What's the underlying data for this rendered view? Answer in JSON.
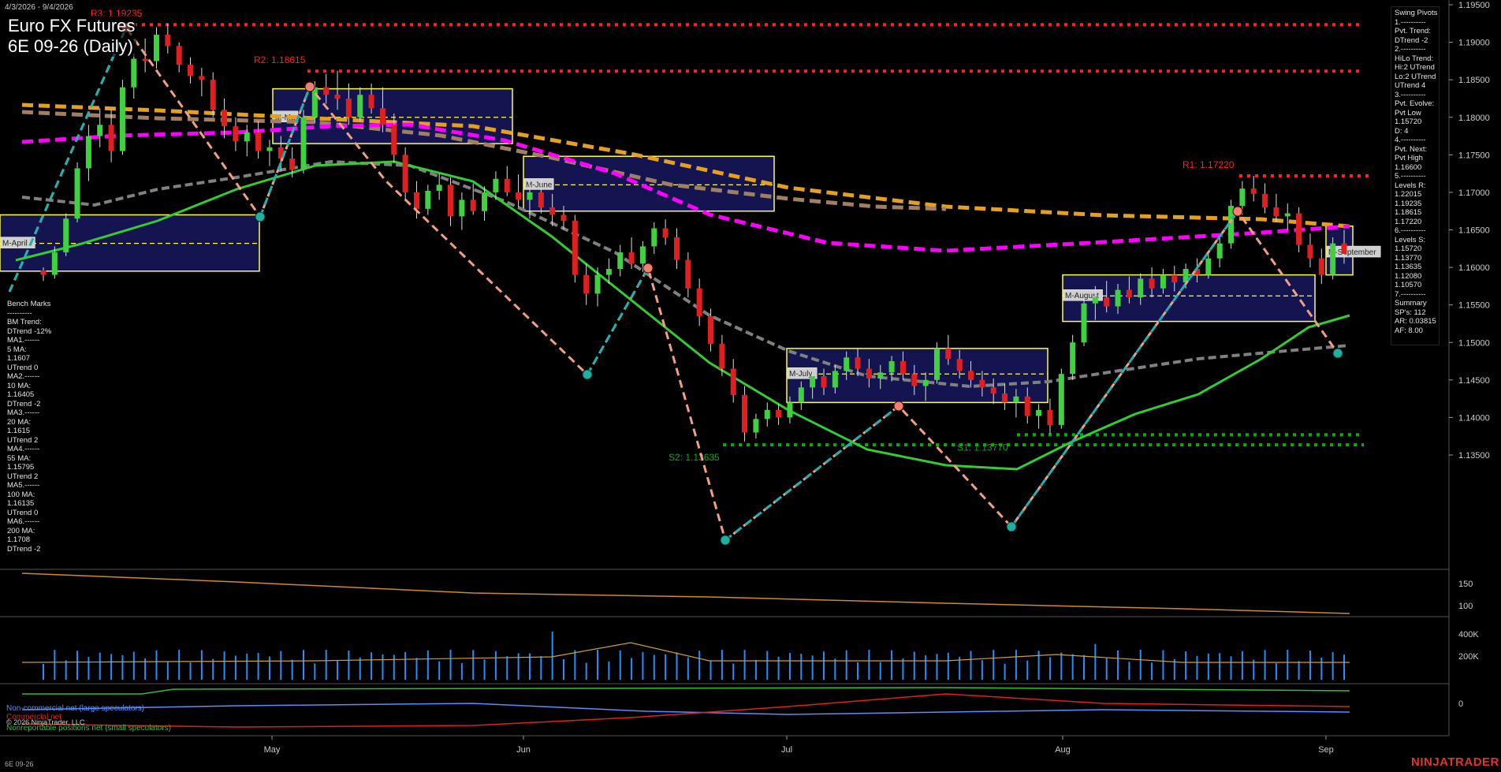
{
  "header": {
    "date_range": "4/3/2026 - 9/4/2026",
    "title_line1": "Euro FX Futures",
    "title_line2": "6E 09-26 (Daily)"
  },
  "footer": {
    "symbol": "6E 09-26",
    "brand": "NINJATRADER"
  },
  "copyright": "© 2026 NinjaTrader, LLC",
  "cot_legend": {
    "noncommercial": "Non-commercial net (large speculators)",
    "commercial": "Commercial net",
    "nonreportable": "Nonreportable positions net (small speculators)"
  },
  "swing_panel": [
    "Swing Pivots",
    "1.----------",
    "Pvt. Trend:",
    "DTrend -2",
    "2.----------",
    "HiLo Trend:",
    "Hi:2 UTrend",
    "Lo:2 UTrend",
    "UTrend 4",
    "3.----------",
    "Pvt. Evolve:",
    "Pvt Low",
    "1.15720",
    "D: 4",
    "4.----------",
    "Pvt. Next:",
    "Pvt High",
    "1.16600",
    "5.----------",
    "Levels R:",
    "1.22015",
    "1.19235",
    "1.18615",
    "1.17220",
    "6.----------",
    "Levels S:",
    "1.15720",
    "1.13770",
    "1.13635",
    "1.12080",
    "1.10570",
    "7.----------",
    "Summary",
    "SP's: 112",
    "AR: 0.03815",
    "AF: 8.00"
  ],
  "bm_panel": [
    "Bench Marks",
    "----------",
    "BM Trend:",
    "DTrend -12%",
    "MA1.------",
    "5 MA:",
    "1.1607",
    "UTrend 0",
    "MA2.------",
    "10 MA:",
    "1.16405",
    "DTrend -2",
    "MA3.------",
    "20 MA:",
    "1.1615",
    "UTrend 2",
    "MA4.------",
    "55 MA:",
    "1.15795",
    "UTrend 2",
    "MA5.------",
    "100 MA:",
    "1.16135",
    "UTrend 0",
    "MA6.------",
    "200 MA:",
    "1.1708",
    "DTrend -2"
  ],
  "colors": {
    "background": "#000000",
    "up_candle": "#3fd13f",
    "down_candle": "#e02020",
    "ma_green": "#33cc33",
    "ma_gray": "#808080",
    "ma_magenta": "#ff00ff",
    "ma_orange": "#e6a020",
    "ma_tan": "#a08060",
    "resistance": "#ff2020",
    "support": "#00b000",
    "swing_up": "#20b0b0",
    "swing_down": "#f0a080",
    "value_area": "#141450",
    "value_area_border": "#ffff40",
    "volume": "#1e90ff",
    "brand": "#e0342b"
  },
  "chart_data": {
    "type": "candlestick",
    "title": "Euro FX Futures 6E 09-26 (Daily)",
    "price_axis": {
      "range": [
        1.131,
        1.1955
      ],
      "ticks": [
        "1.19500",
        "1.19000",
        "1.18500",
        "1.18000",
        "1.17500",
        "1.17000",
        "1.16500",
        "1.16000",
        "1.15500",
        "1.15000",
        "1.14500",
        "1.14000",
        "1.13500"
      ]
    },
    "date_axis_ticks": [
      "May",
      "Jun",
      "Jul",
      "Aug",
      "Sep"
    ],
    "levels": [
      {
        "label": "R3: 1.19235",
        "value": 1.19235,
        "kind": "resistance"
      },
      {
        "label": "R2: 1.18615",
        "value": 1.18615,
        "kind": "resistance"
      },
      {
        "label": "R1: 1.17220",
        "value": 1.1722,
        "kind": "resistance"
      },
      {
        "label": "S2: 1.13635",
        "value": 1.13635,
        "kind": "support"
      },
      {
        "label": "S1: 1.13770",
        "value": 1.1377,
        "kind": "support"
      }
    ],
    "monthly_value_areas": [
      {
        "label": "M-April",
        "high": 1.167,
        "low": 1.1595,
        "mid": 1.1632
      },
      {
        "label": "M-May",
        "high": 1.1838,
        "low": 1.1765,
        "mid": 1.18
      },
      {
        "label": "M-June",
        "high": 1.1748,
        "low": 1.1675,
        "mid": 1.171
      },
      {
        "label": "M-July",
        "high": 1.1492,
        "low": 1.142,
        "mid": 1.1458
      },
      {
        "label": "M-August",
        "high": 1.159,
        "low": 1.1528,
        "mid": 1.1562
      },
      {
        "label": "M-September",
        "high": 1.1655,
        "low": 1.159,
        "mid": 1.162
      }
    ],
    "candles": [
      [
        1.1596,
        1.16,
        1.1582,
        1.159
      ],
      [
        1.159,
        1.1628,
        1.1585,
        1.162
      ],
      [
        1.162,
        1.1672,
        1.1615,
        1.1665
      ],
      [
        1.1665,
        1.174,
        1.166,
        1.1732
      ],
      [
        1.1732,
        1.179,
        1.1715,
        1.1775
      ],
      [
        1.1775,
        1.1812,
        1.176,
        1.179
      ],
      [
        1.179,
        1.181,
        1.174,
        1.1755
      ],
      [
        1.1755,
        1.185,
        1.175,
        1.184
      ],
      [
        1.184,
        1.1885,
        1.1825,
        1.1878
      ],
      [
        1.1878,
        1.1905,
        1.186,
        1.1875
      ],
      [
        1.1875,
        1.192,
        1.1865,
        1.191
      ],
      [
        1.191,
        1.1925,
        1.1885,
        1.1895
      ],
      [
        1.1895,
        1.19,
        1.186,
        1.187
      ],
      [
        1.187,
        1.188,
        1.1845,
        1.1855
      ],
      [
        1.1855,
        1.1866,
        1.1828,
        1.185
      ],
      [
        1.185,
        1.186,
        1.18,
        1.181
      ],
      [
        1.181,
        1.1825,
        1.1772,
        1.1788
      ],
      [
        1.1788,
        1.18,
        1.1755,
        1.1768
      ],
      [
        1.1768,
        1.179,
        1.1748,
        1.178
      ],
      [
        1.178,
        1.1795,
        1.1745,
        1.1755
      ],
      [
        1.1755,
        1.177,
        1.1735,
        1.176
      ],
      [
        1.176,
        1.1775,
        1.1728,
        1.1745
      ],
      [
        1.1745,
        1.176,
        1.172,
        1.173
      ],
      [
        1.173,
        1.181,
        1.1725,
        1.18
      ],
      [
        1.18,
        1.1848,
        1.1792,
        1.184
      ],
      [
        1.184,
        1.1858,
        1.1818,
        1.183
      ],
      [
        1.183,
        1.1862,
        1.181,
        1.1825
      ],
      [
        1.1825,
        1.1845,
        1.179,
        1.18
      ],
      [
        1.18,
        1.184,
        1.1795,
        1.183
      ],
      [
        1.183,
        1.1845,
        1.1805,
        1.1812
      ],
      [
        1.1812,
        1.184,
        1.178,
        1.179
      ],
      [
        1.179,
        1.1805,
        1.174,
        1.175
      ],
      [
        1.175,
        1.176,
        1.169,
        1.17
      ],
      [
        1.17,
        1.1715,
        1.1665,
        1.1678
      ],
      [
        1.1678,
        1.171,
        1.167,
        1.1702
      ],
      [
        1.1702,
        1.1725,
        1.169,
        1.171
      ],
      [
        1.171,
        1.172,
        1.1655,
        1.1668
      ],
      [
        1.1668,
        1.17,
        1.165,
        1.169
      ],
      [
        1.169,
        1.1712,
        1.167,
        1.1675
      ],
      [
        1.1675,
        1.1708,
        1.1662,
        1.17
      ],
      [
        1.17,
        1.1728,
        1.169,
        1.1718
      ],
      [
        1.1718,
        1.1735,
        1.1695,
        1.17
      ],
      [
        1.17,
        1.1724,
        1.168,
        1.169
      ],
      [
        1.169,
        1.171,
        1.1665,
        1.17
      ],
      [
        1.17,
        1.1718,
        1.1672,
        1.168
      ],
      [
        1.168,
        1.1698,
        1.1655,
        1.167
      ],
      [
        1.167,
        1.1682,
        1.165,
        1.1662
      ],
      [
        1.1662,
        1.167,
        1.158,
        1.159
      ],
      [
        1.159,
        1.1605,
        1.155,
        1.1565
      ],
      [
        1.1565,
        1.16,
        1.1548,
        1.159
      ],
      [
        1.159,
        1.1612,
        1.1578,
        1.1598
      ],
      [
        1.1598,
        1.163,
        1.1588,
        1.162
      ],
      [
        1.162,
        1.164,
        1.1598,
        1.1605
      ],
      [
        1.1605,
        1.1635,
        1.1594,
        1.1628
      ],
      [
        1.1628,
        1.166,
        1.1618,
        1.1652
      ],
      [
        1.1652,
        1.1664,
        1.163,
        1.164
      ],
      [
        1.164,
        1.1652,
        1.1598,
        1.161
      ],
      [
        1.161,
        1.162,
        1.156,
        1.1572
      ],
      [
        1.1572,
        1.1585,
        1.1522,
        1.1535
      ],
      [
        1.1535,
        1.1545,
        1.1488,
        1.1498
      ],
      [
        1.1498,
        1.151,
        1.1455,
        1.1465
      ],
      [
        1.1465,
        1.1478,
        1.142,
        1.143
      ],
      [
        1.143,
        1.1442,
        1.1368,
        1.138
      ],
      [
        1.138,
        1.1405,
        1.1372,
        1.1398
      ],
      [
        1.1398,
        1.142,
        1.1388,
        1.141
      ],
      [
        1.141,
        1.1418,
        1.139,
        1.14
      ],
      [
        1.14,
        1.1428,
        1.1392,
        1.142
      ],
      [
        1.142,
        1.1448,
        1.141,
        1.144
      ],
      [
        1.144,
        1.1462,
        1.1425,
        1.1455
      ],
      [
        1.1455,
        1.1465,
        1.143,
        1.144
      ],
      [
        1.144,
        1.147,
        1.1432,
        1.1462
      ],
      [
        1.1462,
        1.1488,
        1.145,
        1.148
      ],
      [
        1.148,
        1.1492,
        1.1455,
        1.1465
      ],
      [
        1.1465,
        1.1478,
        1.144,
        1.1452
      ],
      [
        1.1452,
        1.147,
        1.1438,
        1.146
      ],
      [
        1.146,
        1.1482,
        1.1448,
        1.1475
      ],
      [
        1.1475,
        1.1488,
        1.145,
        1.1458
      ],
      [
        1.1458,
        1.147,
        1.143,
        1.1442
      ],
      [
        1.1442,
        1.146,
        1.1422,
        1.145
      ],
      [
        1.145,
        1.15,
        1.1445,
        1.1492
      ],
      [
        1.1492,
        1.151,
        1.147,
        1.1478
      ],
      [
        1.1478,
        1.149,
        1.1452,
        1.1462
      ],
      [
        1.1462,
        1.1475,
        1.144,
        1.145
      ],
      [
        1.145,
        1.1462,
        1.1428,
        1.144
      ],
      [
        1.144,
        1.1452,
        1.1418,
        1.1432
      ],
      [
        1.1432,
        1.1445,
        1.141,
        1.142
      ],
      [
        1.142,
        1.1438,
        1.14,
        1.1428
      ],
      [
        1.1428,
        1.144,
        1.1392,
        1.1402
      ],
      [
        1.1402,
        1.1418,
        1.1385,
        1.141
      ],
      [
        1.141,
        1.1425,
        1.1378,
        1.139
      ],
      [
        1.139,
        1.1465,
        1.1385,
        1.1458
      ],
      [
        1.1458,
        1.151,
        1.145,
        1.15
      ],
      [
        1.15,
        1.156,
        1.1495,
        1.1552
      ],
      [
        1.1552,
        1.1575,
        1.153,
        1.156
      ],
      [
        1.156,
        1.1582,
        1.154,
        1.1548
      ],
      [
        1.1548,
        1.1578,
        1.1538,
        1.157
      ],
      [
        1.157,
        1.1588,
        1.1552,
        1.156
      ],
      [
        1.156,
        1.1592,
        1.155,
        1.1585
      ],
      [
        1.1585,
        1.16,
        1.156,
        1.1572
      ],
      [
        1.1572,
        1.1598,
        1.1565,
        1.159
      ],
      [
        1.159,
        1.1602,
        1.1568,
        1.158
      ],
      [
        1.158,
        1.1605,
        1.1572,
        1.1598
      ],
      [
        1.1598,
        1.1612,
        1.158,
        1.159
      ],
      [
        1.159,
        1.162,
        1.1585,
        1.1612
      ],
      [
        1.1612,
        1.164,
        1.16,
        1.1632
      ],
      [
        1.1632,
        1.169,
        1.1625,
        1.1682
      ],
      [
        1.1682,
        1.1715,
        1.167,
        1.1705
      ],
      [
        1.1705,
        1.1722,
        1.1688,
        1.1698
      ],
      [
        1.1698,
        1.1712,
        1.1672,
        1.168
      ],
      [
        1.168,
        1.1698,
        1.166,
        1.1668
      ],
      [
        1.1668,
        1.1685,
        1.165,
        1.1672
      ],
      [
        1.1672,
        1.168,
        1.162,
        1.163
      ],
      [
        1.163,
        1.1645,
        1.16,
        1.1612
      ],
      [
        1.1612,
        1.1625,
        1.1578,
        1.159
      ],
      [
        1.159,
        1.164,
        1.1584,
        1.1632
      ],
      [
        1.1632,
        1.165,
        1.1605,
        1.1618
      ]
    ],
    "volume_axis": {
      "ticks": [
        "400K",
        "200K"
      ]
    },
    "cot_axis": {
      "ticks": [
        "0"
      ]
    },
    "oscillator_axis": {
      "ticks": [
        "150",
        "100"
      ]
    }
  }
}
